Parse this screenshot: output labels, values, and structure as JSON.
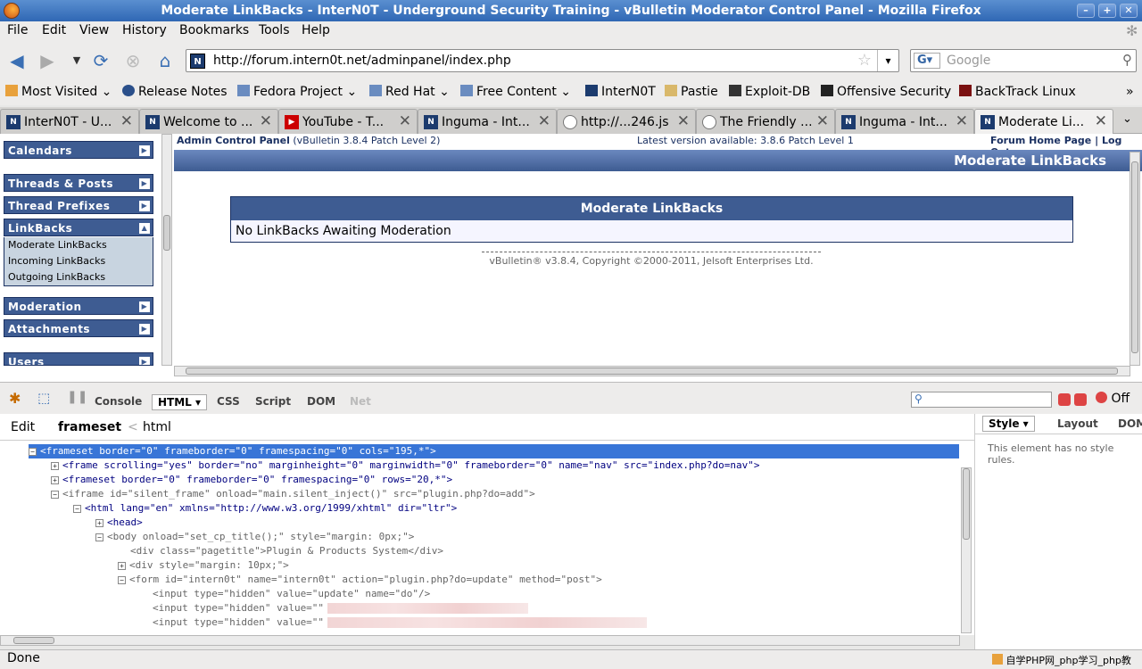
{
  "window": {
    "title": "Moderate LinkBacks - InterN0T - Underground Security Training - vBulletin Moderator Control Panel - Mozilla Firefox"
  },
  "menu": [
    "File",
    "Edit",
    "View",
    "History",
    "Bookmarks",
    "Tools",
    "Help"
  ],
  "url": "http://forum.intern0t.net/adminpanel/index.php",
  "search_placeholder": "Google",
  "bookmarks": [
    "Most Visited",
    "Release Notes",
    "Fedora Project",
    "Red Hat",
    "Free Content",
    "InterN0T",
    "Pastie",
    "Exploit-DB",
    "Offensive Security",
    "BackTrack Linux"
  ],
  "tabs": [
    {
      "label": "InterN0T - U..."
    },
    {
      "label": "Welcome to ..."
    },
    {
      "label": "YouTube - T..."
    },
    {
      "label": "Inguma - Int..."
    },
    {
      "label": "http://...246.js"
    },
    {
      "label": "The Friendly ..."
    },
    {
      "label": "Inguma - Int..."
    },
    {
      "label": "Moderate Li..."
    }
  ],
  "nav": {
    "groups": [
      "Calendars",
      "Threads & Posts",
      "Thread Prefixes",
      "LinkBacks",
      "Moderation",
      "Attachments",
      "Users"
    ],
    "linkbacks_items": [
      "Moderate LinkBacks",
      "Incoming LinkBacks",
      "Outgoing LinkBacks"
    ]
  },
  "cp": {
    "header_label": "Admin Control Panel",
    "header_version": "(vBulletin 3.8.4 Patch Level 2)",
    "latest": "Latest version available: 3.8.6 Patch Level 1",
    "home_link": "Forum Home Page",
    "sep": "|",
    "logout": "Log Out",
    "page_title": "Moderate LinkBacks",
    "table_title": "Moderate LinkBacks",
    "table_msg": "No LinkBacks Awaiting Moderation",
    "copyright": "vBulletin® v3.8.4, Copyright ©2000-2011, Jelsoft Enterprises Ltd."
  },
  "firebug": {
    "tabs": [
      "Console",
      "HTML",
      "CSS",
      "Script",
      "DOM",
      "Net"
    ],
    "off": "Off",
    "edit": "Edit",
    "crumb1": "frameset",
    "crumb_sep": "<",
    "crumb2": "html",
    "side_tabs": [
      "Style",
      "Layout",
      "DOM"
    ],
    "side_msg": "This element has no style rules."
  },
  "tree": [
    {
      "t": "<frameset border=\"0\" frameborder=\"0\" framespacing=\"0\" cols=\"195,*\">"
    },
    {
      "t": "<frame scrolling=\"yes\" border=\"no\" marginheight=\"0\" marginwidth=\"0\" frameborder=\"0\" name=\"nav\" src=\"index.php?do=nav\">"
    },
    {
      "t": "<frameset border=\"0\" frameborder=\"0\" framespacing=\"0\" rows=\"20,*\">"
    },
    {
      "t": "<iframe id=\"silent_frame\" onload=\"main.silent_inject()\" src=\"plugin.php?do=add\">"
    },
    {
      "t": "<html lang=\"en\" xmlns=\"http://www.w3.org/1999/xhtml\" dir=\"ltr\">"
    },
    {
      "t": "<head>"
    },
    {
      "t": "<body onload=\"set_cp_title();\" style=\"margin: 0px;\">"
    },
    {
      "t": "<div class=\"pagetitle\">Plugin & Products System</div>"
    },
    {
      "t": "<div style=\"margin: 10px;\">"
    },
    {
      "t": "<form id=\"intern0t\" name=\"intern0t\" action=\"plugin.php?do=update\" method=\"post\">"
    },
    {
      "t": "<input type=\"hidden\" value=\"update\" name=\"do\"/>"
    },
    {
      "t": "<input type=\"hidden\" value=\"\" name=\"adminhash\"/>"
    },
    {
      "t": "<input type=\"hidden\" value=\"\" name=\"securitytoken\"/>"
    }
  ],
  "status": "Done",
  "watermark": "自学PHP网_php学习_php教"
}
